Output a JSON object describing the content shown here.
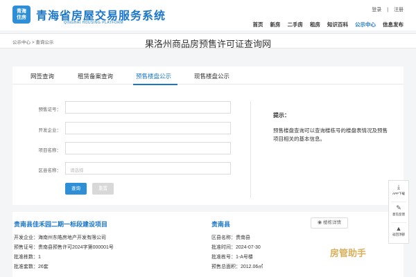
{
  "header": {
    "logo_line1": "青海",
    "logo_line2": "住房",
    "title": "青海省房屋交易服务系统",
    "subtitle": "QINGHAI HOUSING PLATFORM",
    "login": "登录",
    "register": "注册",
    "separator": "|",
    "nav": [
      "首页",
      "新房",
      "二手房",
      "租房",
      "知识百科",
      "公示中心",
      "信息发布"
    ],
    "nav_active_index": 5
  },
  "breadcrumb": {
    "item1": "公示中心",
    "sep": ">",
    "item2": "查询公示"
  },
  "page_title": "果洛州商品房预售许可证查询网",
  "tabs": [
    "网签查询",
    "租赁备案查询",
    "预售楼盘公示",
    "现售楼盘公示"
  ],
  "active_tab_index": 2,
  "form": {
    "permit_label": "预售证号：",
    "developer_label": "开发企业：",
    "project_label": "项目名称：",
    "county_label": "区县名称：",
    "county_placeholder": "请选择",
    "query_button": "查询",
    "reset_button": "重置"
  },
  "hint": {
    "title": "提示：",
    "text": "预售楼盘查询可以查询楼栋号的楼盘表情况及预售项目相关的基本信息。"
  },
  "result": {
    "project_name": "贵南县佳禾园二期一标段建设项目",
    "county_tag": "贵南县",
    "detail_button": "楼栋详情",
    "fields": [
      {
        "label": "开发企业：",
        "value": "海南州东皓房地产开发有限公司"
      },
      {
        "label": "区县名称：",
        "value": "贵南县"
      },
      {
        "label": "预售证号：",
        "value": "贵南县预售许可2024字第000001号"
      },
      {
        "label": "批准时间：",
        "value": "2024-07-30"
      },
      {
        "label": "批准栋数：",
        "value": "1"
      },
      {
        "label": "批准栋号：",
        "value": "1-A号楼"
      },
      {
        "label": "批准套数：",
        "value": "26套"
      },
      {
        "label": "预售总面积：",
        "value": "2012.06㎡"
      }
    ]
  },
  "side_tools": {
    "app_download": "APP下载",
    "feedback": "意见反馈",
    "back_top": "返回顶部"
  },
  "watermark": "房管助手"
}
